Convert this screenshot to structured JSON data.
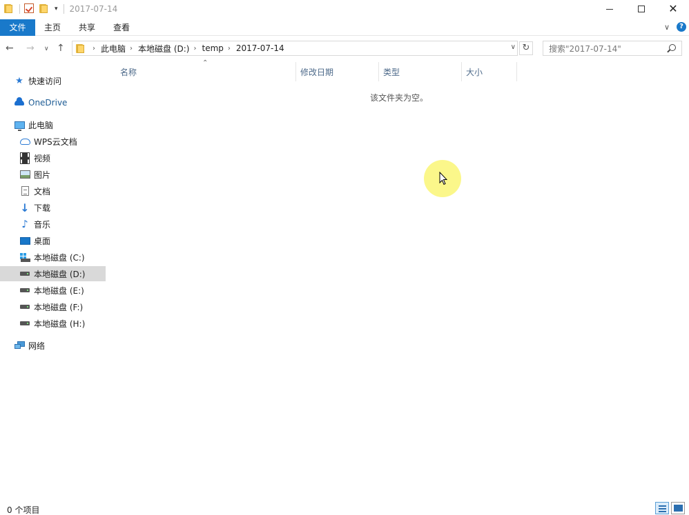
{
  "window": {
    "title": "2017-07-14"
  },
  "ribbon": {
    "tabs": [
      {
        "label": "文件"
      },
      {
        "label": "主页"
      },
      {
        "label": "共享"
      },
      {
        "label": "查看"
      }
    ],
    "help_label": "?"
  },
  "address": {
    "crumbs": [
      "此电脑",
      "本地磁盘 (D:)",
      "temp",
      "2017-07-14"
    ]
  },
  "search": {
    "placeholder": "搜索\"2017-07-14\""
  },
  "sidebar": {
    "items": [
      {
        "label": "快速访问",
        "icon": "star-icon"
      },
      {
        "label": "OneDrive",
        "icon": "onedrive-icon"
      },
      {
        "label": "此电脑",
        "icon": "computer-icon"
      },
      {
        "label": "WPS云文档",
        "icon": "wps-cloud-icon"
      },
      {
        "label": "视频",
        "icon": "video-icon"
      },
      {
        "label": "图片",
        "icon": "picture-icon"
      },
      {
        "label": "文档",
        "icon": "document-icon"
      },
      {
        "label": "下载",
        "icon": "download-icon"
      },
      {
        "label": "音乐",
        "icon": "music-icon"
      },
      {
        "label": "桌面",
        "icon": "desktop-icon"
      },
      {
        "label": "本地磁盘 (C:)",
        "icon": "windows-drive-icon"
      },
      {
        "label": "本地磁盘 (D:)",
        "icon": "drive-icon",
        "selected": true
      },
      {
        "label": "本地磁盘 (E:)",
        "icon": "drive-icon"
      },
      {
        "label": "本地磁盘 (F:)",
        "icon": "drive-icon"
      },
      {
        "label": "本地磁盘 (H:)",
        "icon": "drive-icon"
      },
      {
        "label": "网络",
        "icon": "network-icon"
      }
    ]
  },
  "columns": [
    {
      "label": "名称"
    },
    {
      "label": "修改日期"
    },
    {
      "label": "类型"
    },
    {
      "label": "大小"
    }
  ],
  "content": {
    "empty_message": "该文件夹为空。"
  },
  "status": {
    "item_count": "0 个项目"
  },
  "colors": {
    "accent": "#1979ca",
    "selection": "#d9d9d9",
    "cursor_highlight": "#fbf78a"
  }
}
